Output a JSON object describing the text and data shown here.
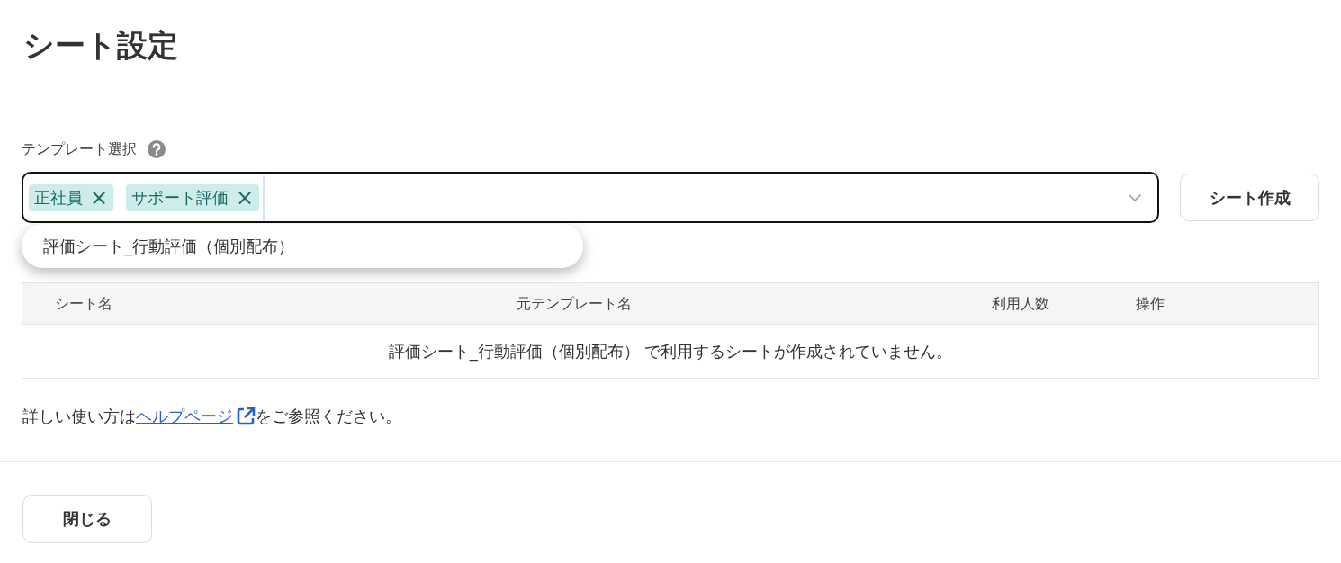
{
  "page": {
    "title": "シート設定"
  },
  "template_select": {
    "label": "テンプレート選択",
    "chips": [
      {
        "label": "正社員",
        "remove": "×"
      },
      {
        "label": "サポート評価",
        "remove": "×"
      }
    ],
    "expanded": true,
    "options": [
      {
        "label": "評価シート_行動評価（個別配布）",
        "selected": false
      }
    ]
  },
  "create_button": {
    "label": "シート作成"
  },
  "table": {
    "columns": [
      "シート名",
      "元テンプレート名",
      "利用人数",
      "操作"
    ],
    "empty_message": "評価シート_行動評価（個別配布） で利用するシートが作成されていません。"
  },
  "help": {
    "before": "詳しい使い方は",
    "link": "ヘルプページ",
    "after": "をご参照ください。"
  },
  "footer": {
    "buttons": [
      "閉じる"
    ]
  }
}
